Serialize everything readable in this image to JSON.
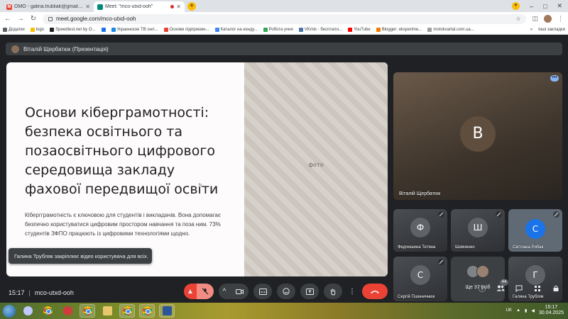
{
  "browser": {
    "tabs": [
      {
        "title": "OMO - galina.trubliak@gmail.co",
        "favicon_color": "#ea4335",
        "favicon_letter": "M",
        "active": false
      },
      {
        "title": "Meet: \"mco-utxd-ooh\"",
        "favicon_color": "#00897b",
        "favicon_letter": "",
        "active": true
      }
    ],
    "new_tab_label": "+",
    "url": "meet.google.com/mco-utxd-ooh",
    "window_controls": [
      "–",
      "□",
      "✕"
    ],
    "bookmarks": [
      {
        "label": "Додатки",
        "color": "#5f6368"
      },
      {
        "label": "logo",
        "color": "#fbbc04"
      },
      {
        "label": "Speedtest.net by O...",
        "color": "#202124"
      },
      {
        "label": "",
        "color": "#1a73e8"
      },
      {
        "label": "Украинское ТВ онл...",
        "color": "#1e88e5"
      },
      {
        "label": "Основи підприємн...",
        "color": "#ea4335"
      },
      {
        "label": "Каталог на конду...",
        "color": "#4285f4"
      },
      {
        "label": "Робота учня",
        "color": "#34a853"
      },
      {
        "label": "VKmix - бесплатн...",
        "color": "#4a76a8"
      },
      {
        "label": "YouTube",
        "color": "#ff0000"
      },
      {
        "label": "Blogger: eksperime...",
        "color": "#f57c00"
      },
      {
        "label": "motokvartal.com.ua...",
        "color": "#9e9e9e"
      }
    ],
    "bookmarks_right": [
      "»",
      "Інші закладки"
    ]
  },
  "meet": {
    "presenter_label": "Віталій Щербатюк (Презентація)",
    "slide": {
      "title": "Основи кіберграмотності: безпека освітнього та позаосвітнього цифрового середовища закладу фахової передвищої освіти",
      "body": "Кібергграмотність є ключовою для студентів і викладачів. Вона допомагає безпечно користуватися цифровим простором навчання та поза ним. 73% студентів ЗФПО працюють із цифровими технологіями щодно.",
      "photo_placeholder": "фото"
    },
    "toast": "Галина Трубляк закріплює відео користувача для всіх.",
    "main_tile": {
      "name": "Віталій Щербатюк",
      "initial": "В",
      "more": "•••"
    },
    "tiles": [
      {
        "name": "Федчишина Тетяна",
        "initial": "Ф"
      },
      {
        "name": "Шевченко",
        "initial": "Ш"
      },
      {
        "name": "Світлана Рибак",
        "initial": "С"
      },
      {
        "name": "Сергій Пшеничнюк",
        "initial": "С"
      },
      {
        "name": "Ще 37 осіб",
        "initial": ""
      },
      {
        "name": "Галина Трубляк",
        "initial": "Г"
      }
    ],
    "bottom": {
      "time": "15:17",
      "meeting_code": "mco-utxd-ooh",
      "people_count": "44"
    }
  },
  "taskbar": {
    "clock_time": "15:17",
    "clock_date": "30.04.2025",
    "lang": "UK"
  }
}
